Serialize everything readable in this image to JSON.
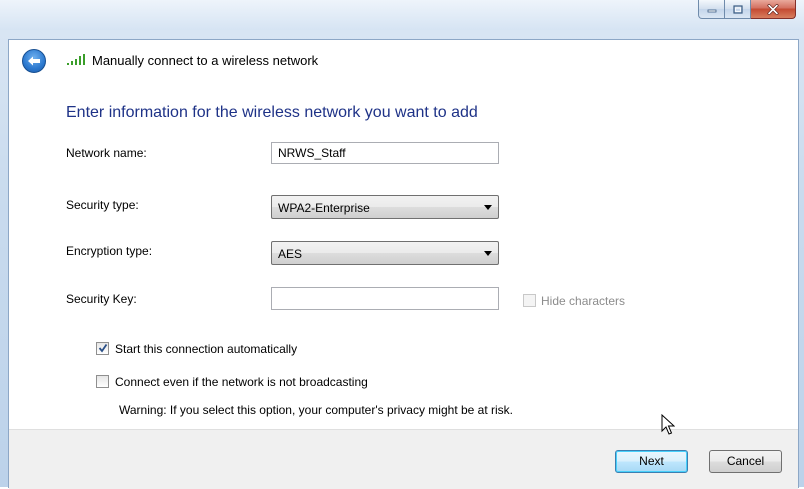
{
  "window": {
    "caption_buttons": [
      "minimize-icon",
      "maximize-icon",
      "close-icon"
    ]
  },
  "nav": {
    "back_icon": "back-arrow-icon",
    "network_icon": "wireless-signal-icon",
    "title": "Manually connect to a wireless network"
  },
  "page": {
    "heading": "Enter information for the wireless network you want to add",
    "accent_color": "#1e3287"
  },
  "form": {
    "network_name": {
      "label": "Network name:",
      "value": "NRWS_Staff"
    },
    "security_type": {
      "label": "Security type:",
      "value": "WPA2-Enterprise"
    },
    "encryption_type": {
      "label": "Encryption type:",
      "value": "AES"
    },
    "security_key": {
      "label": "Security Key:",
      "value": "",
      "hide_label": "Hide characters",
      "hide_checked": false
    },
    "start_auto": {
      "label": "Start this connection automatically",
      "checked": true
    },
    "connect_hidden": {
      "label": "Connect even if the network is not broadcasting",
      "checked": false
    },
    "warning": "Warning: If you select this option, your computer's privacy might be at risk."
  },
  "footer": {
    "next_label": "Next",
    "cancel_label": "Cancel"
  }
}
